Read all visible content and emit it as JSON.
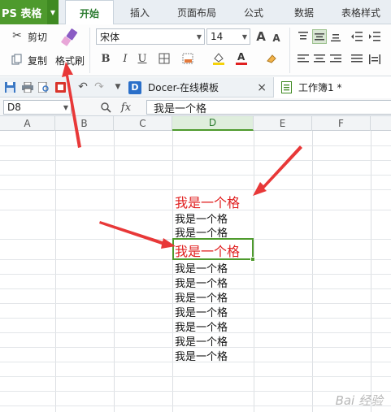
{
  "app": {
    "name": "PS 表格",
    "accent": "#4e9a2d"
  },
  "tabs": [
    {
      "label": "开始",
      "active": true
    },
    {
      "label": "插入"
    },
    {
      "label": "页面布局"
    },
    {
      "label": "公式"
    },
    {
      "label": "数据"
    },
    {
      "label": "表格样式"
    }
  ],
  "ribbon": {
    "cut": "剪切",
    "copy": "复制",
    "format_painter": "格式刷",
    "font_name": "宋体",
    "font_size": "14",
    "bold": "B",
    "italic": "I",
    "underline": "U",
    "grow_font": "A",
    "shrink_font": "A"
  },
  "docs": {
    "template_tab": "Docer-在线模板",
    "workbook_tab": "工作簿1 *",
    "close": "×"
  },
  "formula_bar": {
    "name_box": "D8",
    "fx": "fx",
    "content": "我是一个格"
  },
  "columns": [
    "A",
    "B",
    "C",
    "D",
    "E",
    "F"
  ],
  "selected_column": "D",
  "cells": {
    "d6": "我是一个格",
    "d7a": "我是一个格",
    "d7b": "我是一个格",
    "d8": "我是一个格",
    "d9": "我是一个格",
    "d10": "我是一个格",
    "d11": "我是一个格",
    "d12": "我是一个格",
    "d13": "我是一个格",
    "d14": "我是一个格",
    "d15": "我是一个格"
  },
  "watermark": "Bai 经验",
  "colors": {
    "red_text": "#e02020",
    "annotation_arrow": "#e83838",
    "selection": "#4e9a2d"
  }
}
